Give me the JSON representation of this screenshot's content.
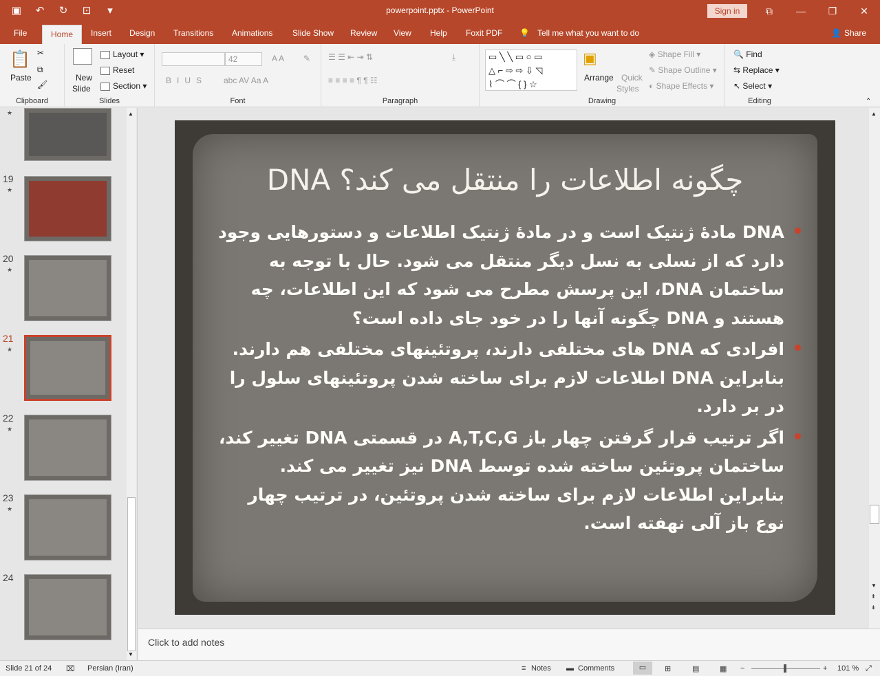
{
  "window": {
    "title": "powerpoint.pptx  -  PowerPoint",
    "sign_in": "Sign in"
  },
  "tabs": [
    "File",
    "Home",
    "Insert",
    "Design",
    "Transitions",
    "Animations",
    "Slide Show",
    "Review",
    "View",
    "Help",
    "Foxit PDF"
  ],
  "tell_me": "Tell me what you want to do",
  "share": "Share",
  "ribbon": {
    "clipboard": {
      "paste": "Paste",
      "label": "Clipboard"
    },
    "slides": {
      "new_slide": "New",
      "new_slide2": "Slide",
      "layout": "Layout",
      "reset": "Reset",
      "section": "Section",
      "label": "Slides"
    },
    "font": {
      "size": "42",
      "label": "Font"
    },
    "paragraph": {
      "label": "Paragraph"
    },
    "drawing": {
      "arrange": "Arrange",
      "quick": "Quick",
      "styles": "Styles",
      "shape_fill": "Shape Fill",
      "shape_outline": "Shape Outline",
      "shape_effects": "Shape Effects",
      "label": "Drawing"
    },
    "editing": {
      "find": "Find",
      "replace": "Replace",
      "select": "Select",
      "label": "Editing"
    }
  },
  "thumbnails": [
    {
      "num": "",
      "top": 0
    },
    {
      "num": "19"
    },
    {
      "num": "20"
    },
    {
      "num": "21"
    },
    {
      "num": "22"
    },
    {
      "num": "23"
    },
    {
      "num": "24"
    }
  ],
  "slide": {
    "title": "DNA چگونه اطلاعات را منتقل می کند؟",
    "bullets": [
      "DNA مادۀ ژنتیک است و در مادۀ ژنتیک اطلاعات و دستورهایی وجود دارد که از نسلی به نسل دیگر منتقل می شود. حال با توجه به ساختمان DNA، این پرسش مطرح می شود که این اطلاعات، چه هستند و DNA چگونه آنها را در خود جای داده است؟",
      "افرادی که DNA های مختلفی دارند، پروتئینهای مختلفی هم دارند. بنابراین  DNA اطلاعات لازم برای ساخته شدن پروتئینهای سلول را در بر دارد.",
      "اگر ترتیب قرار گرفتن چهار باز A,T,C,G در قسمتی DNA تغییر کند، ساختمان پروتئین ساخته شده توسط  DNA نیز تغییر می کند."
    ],
    "extra": "بنابراین اطلاعات لازم برای ساخته شدن پروتئین، در ترتیب چهار نوع باز آلی نهفته است."
  },
  "notes_placeholder": "Click to add notes",
  "status": {
    "slide": "Slide 21 of 24",
    "language": "Persian (Iran)",
    "notes": "Notes",
    "comments": "Comments",
    "zoom": "101 %"
  },
  "colors": {
    "accent": "#b7472a",
    "bullet": "#c9432b"
  }
}
